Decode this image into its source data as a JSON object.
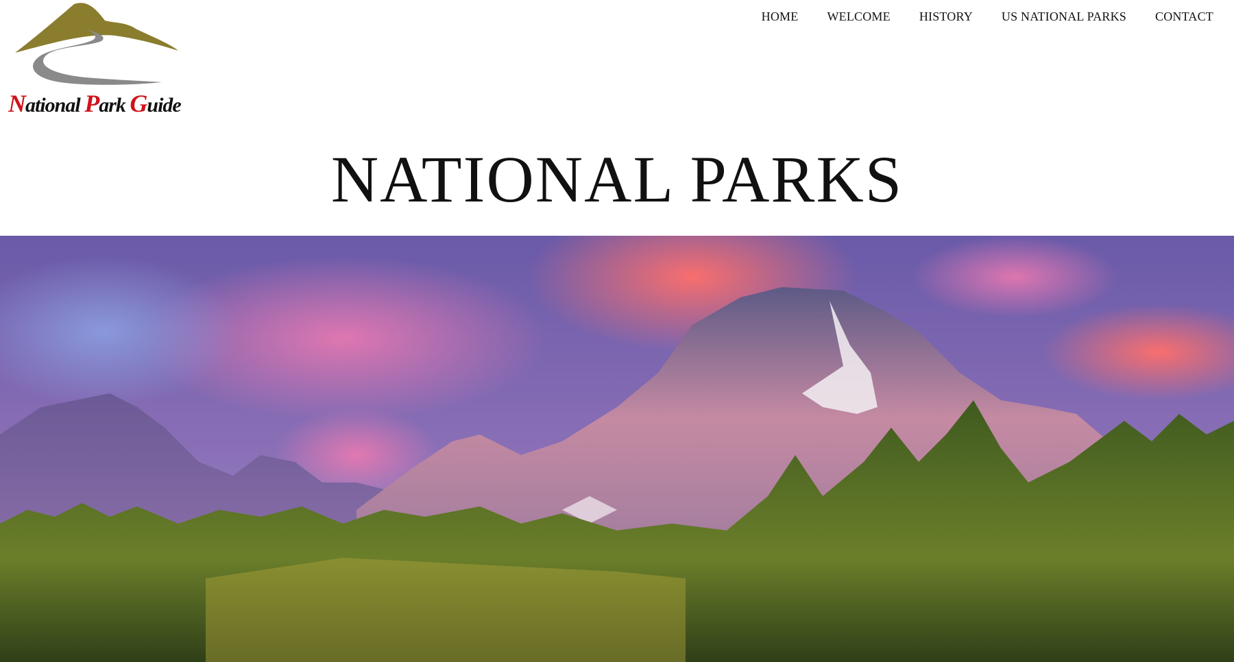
{
  "logo": {
    "text_parts": [
      {
        "cap": "N",
        "rest": "ational "
      },
      {
        "cap": "P",
        "rest": "ark "
      },
      {
        "cap": "G",
        "rest": "uide"
      }
    ],
    "colors": {
      "mountain": "#8a7d2e",
      "road": "#8a8a8a",
      "caps": "#d0121b"
    }
  },
  "nav": {
    "items": [
      "HOME",
      "WELCOME",
      "HISTORY",
      "US NATIONAL PARKS",
      "CONTACT"
    ]
  },
  "page": {
    "title": "NATIONAL PARKS"
  },
  "hero": {
    "icon": "mountain-landscape-image"
  }
}
